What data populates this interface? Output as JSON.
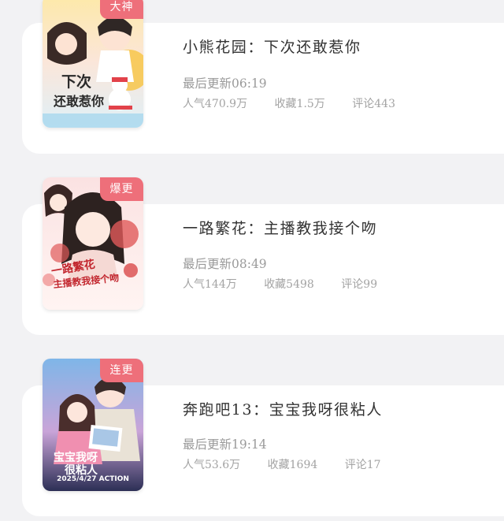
{
  "colors": {
    "background": "#f2f2f4",
    "card": "#ffffff",
    "badge": "#ee6f7a",
    "title_text": "#333333",
    "meta_text": "#9a9a9a"
  },
  "books": [
    {
      "badge": "大神",
      "title": "小熊花园：下次还敢惹你",
      "updated": "最后更新06:19",
      "popularity": "人气470.9万",
      "favorites": "收藏1.5万",
      "comments": "评论443",
      "cover_text": "下次还敢惹你"
    },
    {
      "badge": "爆更",
      "title": "一路繁花：主播教我接个吻",
      "updated": "最后更新08:49",
      "popularity": "人气144万",
      "favorites": "收藏5498",
      "comments": "评论99",
      "cover_text": "一路繁花 主播教我接个吻"
    },
    {
      "badge": "连更",
      "title": "奔跑吧13：宝宝我呀很粘人",
      "updated": "最后更新19:14",
      "popularity": "人气53.6万",
      "favorites": "收藏1694",
      "comments": "评论17",
      "cover_text": "宝宝我呀很粘人",
      "cover_date": "2025/4/27 ACTION"
    }
  ]
}
